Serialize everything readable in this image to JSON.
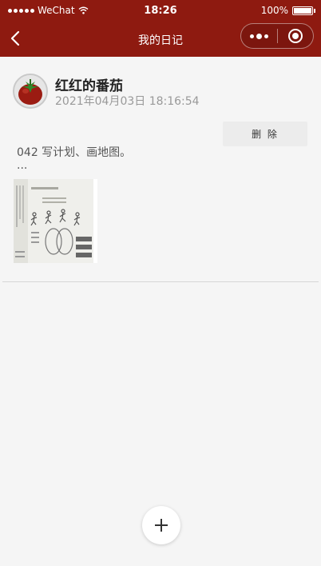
{
  "status_bar": {
    "carrier": "WeChat",
    "time": "18:26",
    "battery_text": "100%",
    "battery_level": 1.0
  },
  "nav": {
    "title": "我的日记",
    "back_icon": "chevron-left-icon",
    "more_icon": "more-dots-icon",
    "close_icon": "target-circle-icon"
  },
  "entry": {
    "username": "红红的番茄",
    "timestamp": "2021年04月03日 18:16:54",
    "delete_label": "删 除",
    "content": "042 写计划、画地图。",
    "ellipsis": "...",
    "avatar_icon": "tomato-icon",
    "photo_icon": "book-cover-image"
  },
  "add_button": {
    "icon": "plus-icon"
  },
  "colors": {
    "brand": "#8e1a10",
    "background": "#f5f5f5",
    "delete_bg": "#ececec"
  }
}
